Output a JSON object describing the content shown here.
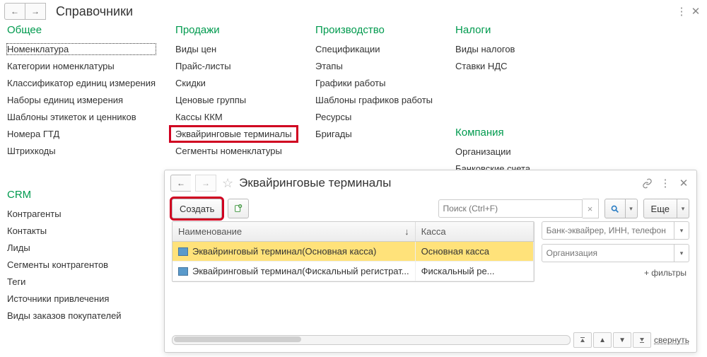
{
  "titlebar": {
    "title": "Справочники"
  },
  "columns": {
    "general": {
      "header": "Общее",
      "items": [
        "Номенклатура",
        "Категории номенклатуры",
        "Классификатор единиц измерения",
        "Наборы единиц измерения",
        "Шаблоны этикеток и ценников",
        "Номера ГТД",
        "Штрихкоды"
      ]
    },
    "crm": {
      "header": "CRM",
      "items": [
        "Контрагенты",
        "Контакты",
        "Лиды",
        "Сегменты контрагентов",
        "Теги",
        "Источники привлечения",
        "Виды заказов покупателей"
      ]
    },
    "sales": {
      "header": "Продажи",
      "items": [
        "Виды цен",
        "Прайс-листы",
        "Скидки",
        "Ценовые группы",
        "Кассы ККМ",
        "Эквайринговые терминалы",
        "Сегменты номенклатуры"
      ]
    },
    "production": {
      "header": "Производство",
      "items": [
        "Спецификации",
        "Этапы",
        "Графики работы",
        "Шаблоны графиков работы",
        "Ресурсы",
        "Бригады"
      ]
    },
    "taxes": {
      "header": "Налоги",
      "items": [
        "Виды налогов",
        "Ставки НДС"
      ]
    },
    "company": {
      "header": "Компания",
      "items": [
        "Организации",
        "Банковские счета"
      ]
    }
  },
  "subwin": {
    "title": "Эквайринговые терминалы",
    "create": "Создать",
    "search_ph": "Поиск (Ctrl+F)",
    "more": "Еще",
    "table": {
      "col_name": "Наименование",
      "col_kassa": "Касса",
      "rows": [
        {
          "name": "Эквайринговый терминал(Основная касса)",
          "kassa": "Основная касса",
          "selected": true
        },
        {
          "name": "Эквайринговый терминал(Фискальный регистрат...",
          "kassa": "Фискальный ре...",
          "selected": false
        }
      ]
    },
    "filters": {
      "bank_ph": "Банк-эквайрер, ИНН, телефон",
      "org_ph": "Организация",
      "more_filters": "+ фильтры"
    },
    "collapse": "свернуть"
  }
}
